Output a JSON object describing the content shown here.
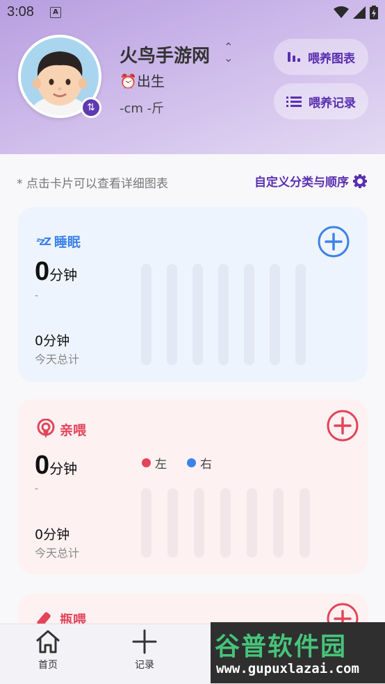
{
  "status_bar": {
    "time": "3:08",
    "notif_letter": "A"
  },
  "profile": {
    "name": "火鸟手游网",
    "birth_label": "出生",
    "measurements": "-cm -斤"
  },
  "header_buttons": {
    "chart": "喂养图表",
    "records": "喂养记录"
  },
  "hint": "* 点击卡片可以查看详细图表",
  "customize": "自定义分类与顺序",
  "colors": {
    "accent": "#5a2fb0",
    "sleep": "#3d82e8",
    "feed": "#e2455a",
    "left_dot": "#e2455a",
    "right_dot": "#3d82e8"
  },
  "cards": {
    "sleep": {
      "title": "睡眠",
      "icon": "zzz-icon",
      "big_value": "0",
      "big_unit": "分钟",
      "dash": "-",
      "total": "0分钟",
      "total_label": "今天总计"
    },
    "breastfeed": {
      "title": "亲喂",
      "icon": "breastfeed-icon",
      "big_value": "0",
      "big_unit": "分钟",
      "dash": "-",
      "legend_left": "左",
      "legend_right": "右",
      "total": "0分钟",
      "total_label": "今天总计"
    },
    "bottle": {
      "title": "瓶喂",
      "icon": "bottle-icon"
    }
  },
  "tabs": [
    {
      "label": "首页",
      "icon": "home-icon"
    },
    {
      "label": "记录",
      "icon": "plus-icon"
    }
  ],
  "watermark": {
    "title": "谷普软件园",
    "url": "www.gupuxlazai.com"
  }
}
